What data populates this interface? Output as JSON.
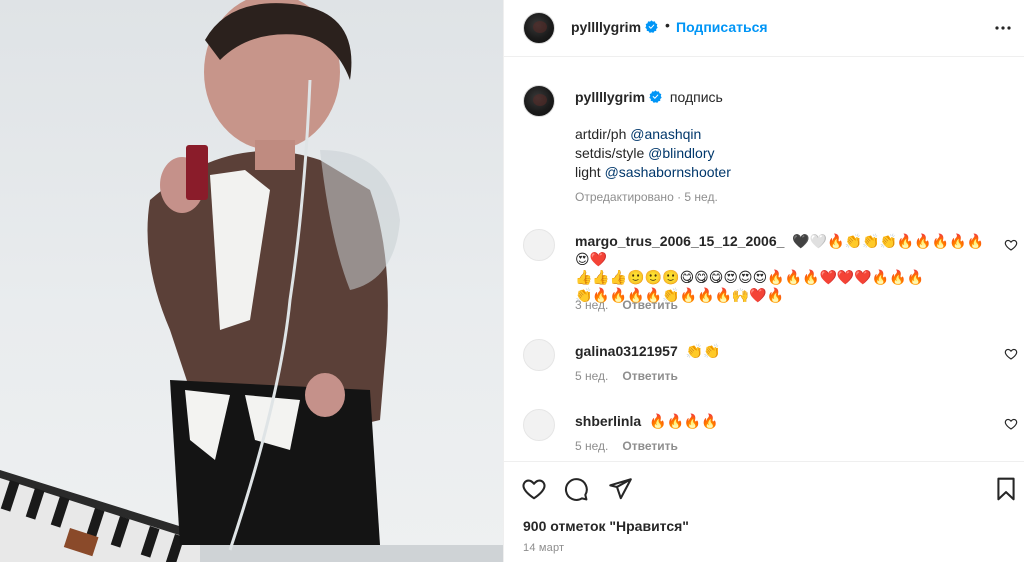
{
  "post": {
    "username": "pyllllygrim",
    "follow_label": "Подписаться",
    "separator": "•",
    "caption": {
      "username": "pyllllygrim",
      "suffix": "подпись",
      "lines": [
        {
          "prefix": "artdir/ph ",
          "mention": "@anashqin"
        },
        {
          "prefix": "setdis/style ",
          "mention": "@blindlory"
        },
        {
          "prefix": "light ",
          "mention": "@sashabornshooter"
        }
      ],
      "edited": "Отредактировано · 5 нед."
    },
    "comments": [
      {
        "username": "margo_trus_2006_15_12_2006_",
        "lines": [
          "🖤🤍🔥👏👏👏🔥🔥🔥🔥🔥😍❤️",
          "👍👍👍🙂🙂🙂😋😋😋😍😍😍🔥🔥🔥❤️❤️❤️🔥🔥🔥",
          "👏🔥🔥🔥🔥👏🔥🔥🔥🙌❤️🔥"
        ],
        "time": "3 нед.",
        "reply": "Ответить"
      },
      {
        "username": "galina03121957",
        "lines": [
          "👏👏"
        ],
        "time": "5 нед.",
        "reply": "Ответить"
      },
      {
        "username": "shberlinla",
        "lines": [
          "🔥🔥🔥🔥"
        ],
        "time": "5 нед.",
        "reply": "Ответить"
      }
    ],
    "likes": "900 отметок \"Нравится\"",
    "date": "14 март"
  },
  "icons": {
    "verified": "verified-badge-icon",
    "more": "more-options-icon",
    "like": "heart-icon",
    "comment": "comment-icon",
    "share": "share-icon",
    "save": "bookmark-icon"
  },
  "colors": {
    "accent": "#0095f6",
    "mention": "#00376b",
    "muted": "#8e8e8e"
  }
}
